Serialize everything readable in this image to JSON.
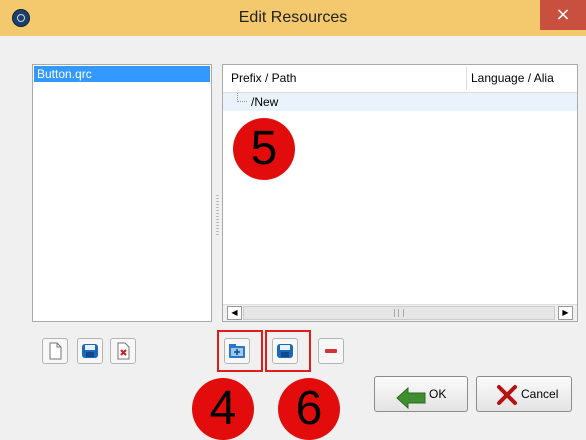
{
  "window": {
    "title": "Edit Resources",
    "close_glyph": "×",
    "icon": "qt-creator-app-icon"
  },
  "files": {
    "items": [
      {
        "label": "Button.qrc",
        "selected": true
      }
    ]
  },
  "tree": {
    "columns": [
      "Prefix / Path",
      "Language / Alia"
    ],
    "rows": [
      {
        "label": "/New",
        "depth": 1
      }
    ]
  },
  "scrollbar": {
    "left_glyph": "◀",
    "right_glyph": "▶"
  },
  "file_toolbar": {
    "icons": [
      "new-file-icon",
      "save-icon",
      "remove-file-icon"
    ]
  },
  "resource_toolbar": {
    "icons": [
      "add-prefix-icon",
      "add-files-icon",
      "remove-icon"
    ]
  },
  "callouts": {
    "a": "5",
    "b": "4",
    "c": "6"
  },
  "buttons": {
    "ok": "OK",
    "cancel": "Cancel"
  },
  "colors": {
    "titlebar": "#f4c96d",
    "selection": "#3399ff",
    "callout": "#e20c0c",
    "highlight_border": "#e21b1b"
  }
}
